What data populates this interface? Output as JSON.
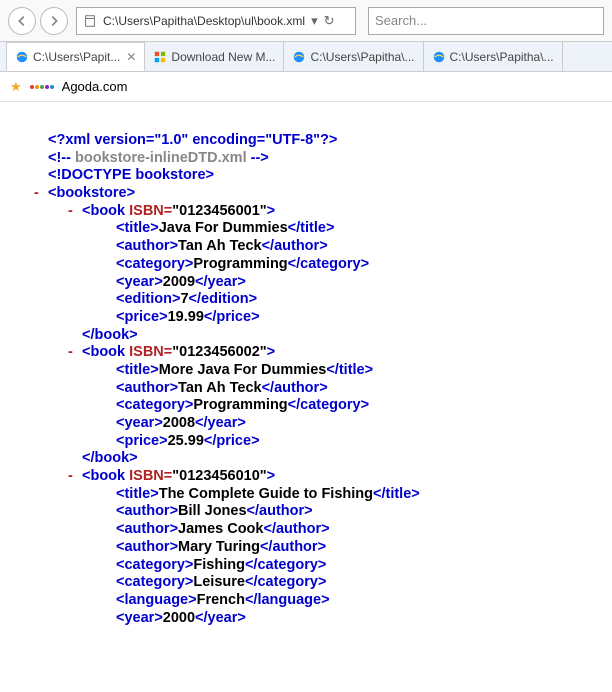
{
  "toolbar": {
    "address": "C:\\Users\\Papitha\\Desktop\\ul\\book.xml",
    "search_placeholder": "Search..."
  },
  "tabs": [
    {
      "label": "C:\\Users\\Papit...",
      "active": true
    },
    {
      "label": "Download New M...",
      "active": false
    },
    {
      "label": "C:\\Users\\Papitha\\...",
      "active": false
    },
    {
      "label": "C:\\Users\\Papitha\\...",
      "active": false
    }
  ],
  "favbar": {
    "label": "Agoda.com"
  },
  "xml": {
    "decl": "<?xml version=\"1.0\" encoding=\"UTF-8\"?>",
    "comment_open": "<!--",
    "comment_text": " bookstore-inlineDTD.xml ",
    "comment_close": "-->",
    "doctype": "<!DOCTYPE bookstore>",
    "root_open": "bookstore",
    "book_tag": "book",
    "isbn_attr": "ISBN",
    "title_tag": "title",
    "author_tag": "author",
    "category_tag": "category",
    "year_tag": "year",
    "edition_tag": "edition",
    "price_tag": "price",
    "language_tag": "language",
    "books": [
      {
        "isbn": "0123456001",
        "title": "Java For Dummies",
        "author": "Tan Ah Teck",
        "category": "Programming",
        "year": "2009",
        "edition": "7",
        "price": "19.99"
      },
      {
        "isbn": "0123456002",
        "title": "More Java For Dummies",
        "author": "Tan Ah Teck",
        "category": "Programming",
        "year": "2008",
        "price": "25.99"
      },
      {
        "isbn": "0123456010",
        "title": "The Complete Guide to Fishing",
        "authors": [
          "Bill Jones",
          "James Cook",
          "Mary Turing"
        ],
        "categories": [
          "Fishing",
          "Leisure"
        ],
        "language": "French",
        "year": "2000"
      }
    ]
  }
}
